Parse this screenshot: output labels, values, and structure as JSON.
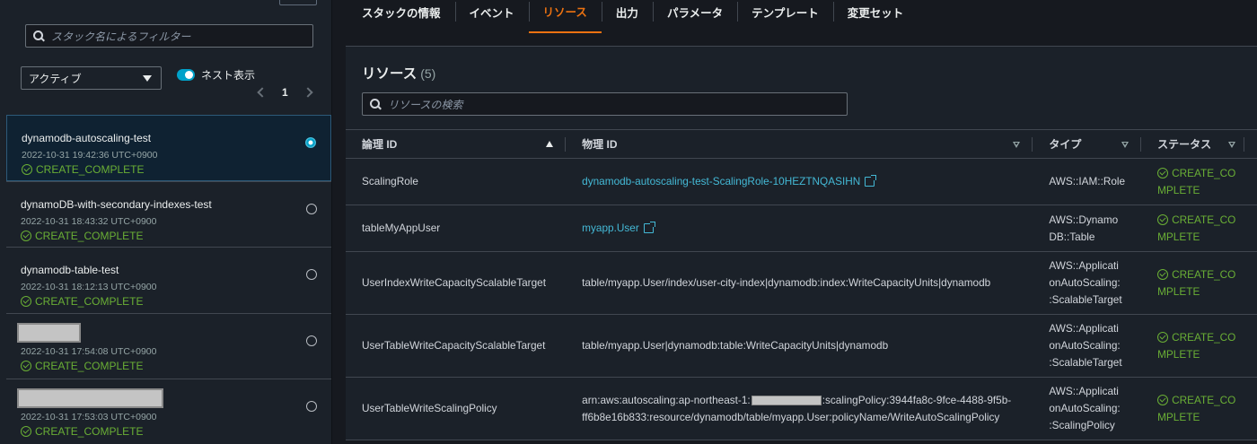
{
  "sidebar": {
    "filter_placeholder": "スタック名によるフィルター",
    "status_filter": "アクティブ",
    "nested_toggle_label": "ネスト表示",
    "page": "1",
    "stacks": [
      {
        "name": "dynamodb-autoscaling-test",
        "date": "2022-10-31 19:42:36 UTC+0900",
        "status": "CREATE_COMPLETE"
      },
      {
        "name": "dynamoDB-with-secondary-indexes-test",
        "date": "2022-10-31 18:43:32 UTC+0900",
        "status": "CREATE_COMPLETE"
      },
      {
        "name": "dynamodb-table-test",
        "date": "2022-10-31 18:12:13 UTC+0900",
        "status": "CREATE_COMPLETE"
      },
      {
        "name": "",
        "date": "2022-10-31 17:54:08 UTC+0900",
        "status": "CREATE_COMPLETE"
      },
      {
        "name": "",
        "date": "2022-10-31 17:53:03 UTC+0900",
        "status": "CREATE_COMPLETE"
      }
    ]
  },
  "tabs": [
    "スタックの情報",
    "イベント",
    "リソース",
    "出力",
    "パラメータ",
    "テンプレート",
    "変更セット"
  ],
  "resources": {
    "title": "リソース",
    "count": "(5)",
    "search_placeholder": "リソースの検索",
    "columns": {
      "logical_id": "論理 ID",
      "physical_id": "物理 ID",
      "type": "タイプ",
      "status": "ステータス"
    },
    "rows": [
      {
        "logical_id": "ScalingRole",
        "physical_id": "dynamodb-autoscaling-test-ScalingRole-10HEZTNQASIHN",
        "type_1": "AWS::IAM::Role",
        "type_2": "",
        "type_3": "",
        "status_1": "CREATE_CO",
        "status_2": "MPLETE"
      },
      {
        "logical_id": "tableMyAppUser",
        "physical_id": "myapp.User",
        "type_1": "AWS::Dynamo",
        "type_2": "DB::Table",
        "type_3": "",
        "status_1": "CREATE_CO",
        "status_2": "MPLETE"
      },
      {
        "logical_id": "UserIndexWriteCapacityScalableTarget",
        "physical_id": "table/myapp.User/index/user-city-index|dynamodb:index:WriteCapacityUnits|dynamodb",
        "type_1": "AWS::Applicati",
        "type_2": "onAutoScaling:",
        "type_3": ":ScalableTarget",
        "status_1": "CREATE_CO",
        "status_2": "MPLETE"
      },
      {
        "logical_id": "UserTableWriteCapacityScalableTarget",
        "physical_id": "table/myapp.User|dynamodb:table:WriteCapacityUnits|dynamodb",
        "type_1": "AWS::Applicati",
        "type_2": "onAutoScaling:",
        "type_3": ":ScalableTarget",
        "status_1": "CREATE_CO",
        "status_2": "MPLETE"
      },
      {
        "logical_id": "UserTableWriteScalingPolicy",
        "physical_id_pre": "arn:aws:autoscaling:ap-northeast-1:",
        "physical_id_post": ":scalingPolicy:3944fa8c-9fce-4488-9f5b-",
        "physical_id_line2": "ff6b8e16b833:resource/dynamodb/table/myapp.User:policyName/WriteAutoScalingPolicy",
        "type_1": "AWS::Applicati",
        "type_2": "onAutoScaling:",
        "type_3": ":ScalingPolicy",
        "status_1": "CREATE_CO",
        "status_2": "MPLETE"
      }
    ]
  }
}
